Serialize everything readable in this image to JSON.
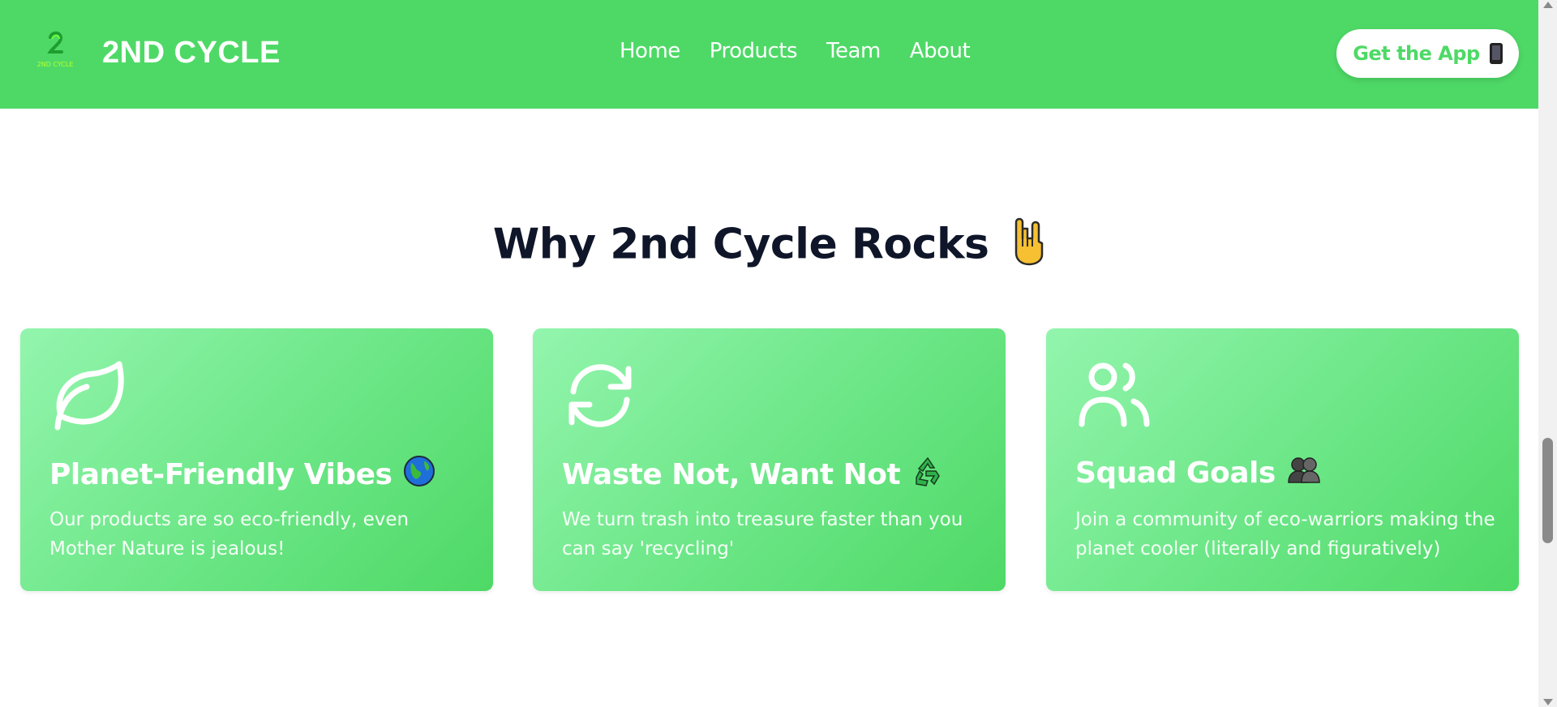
{
  "header": {
    "brand": "2ND CYCLE",
    "logo_text": "2ND CYCLE",
    "nav": [
      "Home",
      "Products",
      "Team",
      "About"
    ],
    "cta_label": "Get the App",
    "cta_icon": "mobile-phone-icon"
  },
  "section": {
    "title": "Why 2nd Cycle Rocks",
    "title_icon": "rock-on-hand-icon"
  },
  "cards": [
    {
      "icon": "leaf-icon",
      "title": "Planet-Friendly Vibes",
      "title_icon": "globe-icon",
      "description": "Our products are so eco-friendly, even Mother Nature is jealous!"
    },
    {
      "icon": "refresh-cycle-icon",
      "title": "Waste Not, Want Not",
      "title_icon": "recycling-icon",
      "description": "We turn trash into treasure faster than you can say 'recycling'"
    },
    {
      "icon": "users-icon",
      "title": "Squad Goals",
      "title_icon": "two-people-icon",
      "description": "Join a community of eco-warriors making the planet cooler (literally and figuratively)"
    }
  ],
  "colors": {
    "brand_green": "#4ed966",
    "card_gradient_start": "#93f5ad",
    "heading_dark": "#0f1629"
  }
}
